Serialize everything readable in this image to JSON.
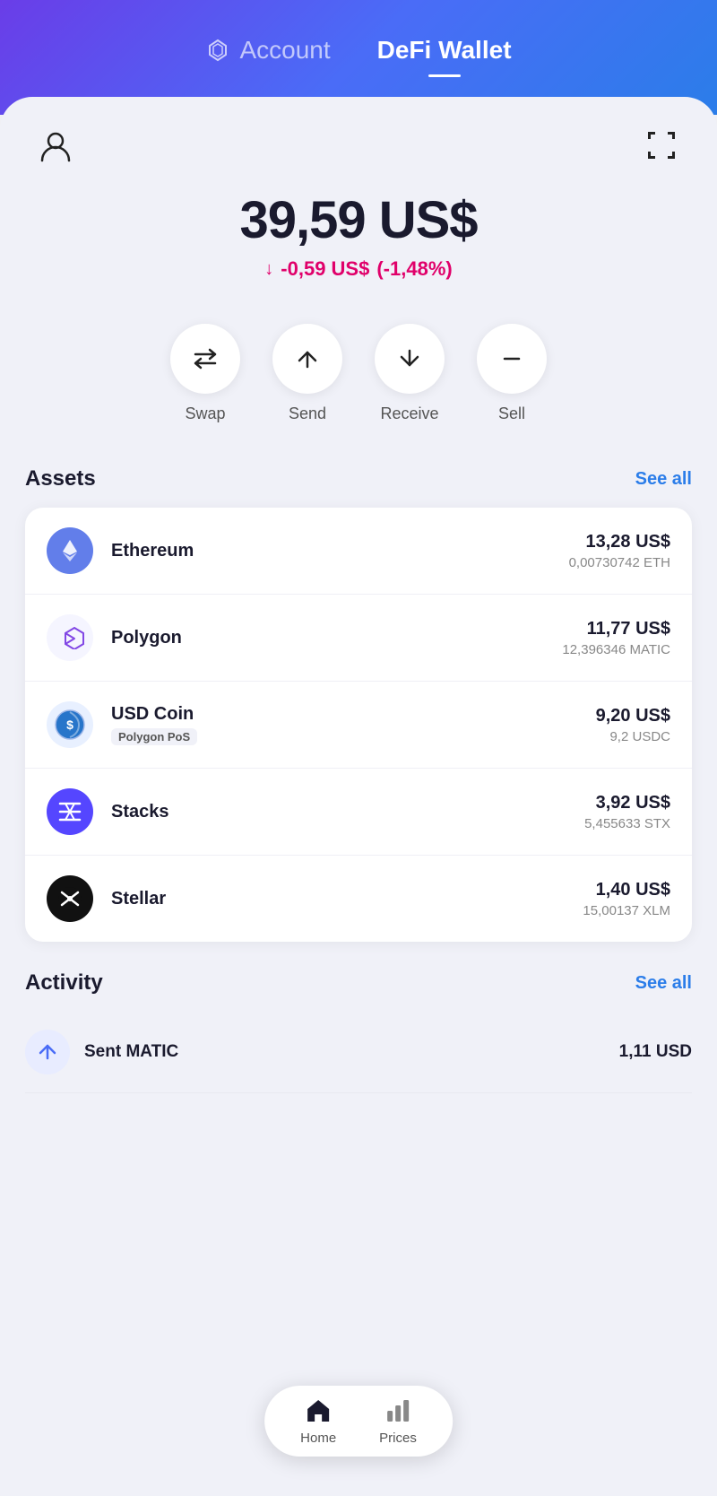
{
  "header": {
    "account_tab": "Account",
    "defi_tab": "DeFi Wallet",
    "active_tab": "defi"
  },
  "balance": {
    "amount": "39,59 US$",
    "change_text": "-0,59 US$",
    "change_pct": "(-1,48%)"
  },
  "actions": [
    {
      "id": "swap",
      "label": "Swap"
    },
    {
      "id": "send",
      "label": "Send"
    },
    {
      "id": "receive",
      "label": "Receive"
    },
    {
      "id": "sell",
      "label": "Sell"
    }
  ],
  "assets": {
    "title": "Assets",
    "see_all": "See all",
    "items": [
      {
        "name": "Ethereum",
        "icon_type": "eth",
        "usd": "13,28 US$",
        "amount": "0,00730742 ETH"
      },
      {
        "name": "Polygon",
        "icon_type": "polygon",
        "usd": "11,77 US$",
        "amount": "12,396346 MATIC"
      },
      {
        "name": "USD Coin",
        "icon_type": "usdc",
        "badge": "Polygon PoS",
        "usd": "9,20 US$",
        "amount": "9,2 USDC"
      },
      {
        "name": "Stacks",
        "icon_type": "stacks",
        "usd": "3,92 US$",
        "amount": "5,455633 STX"
      },
      {
        "name": "Stellar",
        "icon_type": "stellar",
        "usd": "1,40 US$",
        "amount": "15,00137 XLM"
      }
    ]
  },
  "activity": {
    "title": "Activity",
    "see_all": "See all",
    "items": [
      {
        "name": "Sent MATIC",
        "value": "1,11 USD"
      }
    ]
  },
  "bottom_nav": {
    "home_label": "Home",
    "prices_label": "Prices"
  }
}
